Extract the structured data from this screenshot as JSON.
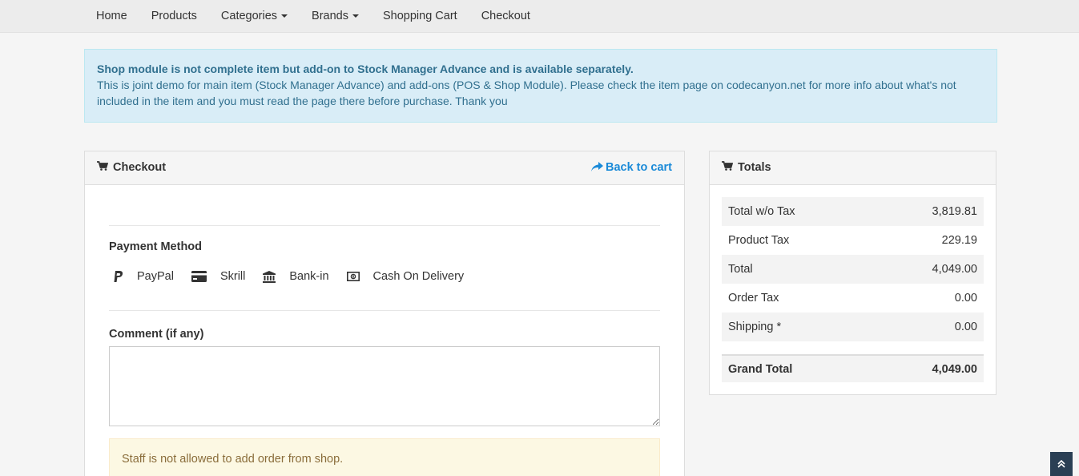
{
  "nav": {
    "items": [
      {
        "label": "Home",
        "dropdown": false
      },
      {
        "label": "Products",
        "dropdown": false
      },
      {
        "label": "Categories",
        "dropdown": true
      },
      {
        "label": "Brands",
        "dropdown": true
      },
      {
        "label": "Shopping Cart",
        "dropdown": false
      },
      {
        "label": "Checkout",
        "dropdown": false
      }
    ]
  },
  "notice": {
    "title": "Shop module is not complete item but add-on to Stock Manager Advance and is available separately.",
    "body": "This is joint demo for main item (Stock Manager Advance) and add-ons (POS & Shop Module). Please check the item page on codecanyon.net for more info about what's not included in the item and you must read the page there before purchase. Thank you"
  },
  "checkout": {
    "title": "Checkout",
    "back_label": "Back to cart",
    "payment_label": "Payment Method",
    "payment_methods": [
      {
        "label": "PayPal",
        "icon": "paypal-icon"
      },
      {
        "label": "Skrill",
        "icon": "credit-card-icon"
      },
      {
        "label": "Bank-in",
        "icon": "bank-icon"
      },
      {
        "label": "Cash On Delivery",
        "icon": "money-icon"
      }
    ],
    "comment_label": "Comment (if any)",
    "comment_value": "",
    "warning": "Staff is not allowed to add order from shop."
  },
  "totals": {
    "title": "Totals",
    "rows": [
      {
        "label": "Total w/o Tax",
        "value": "3,819.81"
      },
      {
        "label": "Product Tax",
        "value": "229.19"
      },
      {
        "label": "Total",
        "value": "4,049.00"
      },
      {
        "label": "Order Tax",
        "value": "0.00"
      },
      {
        "label": "Shipping *",
        "value": "0.00"
      }
    ],
    "grand_label": "Grand Total",
    "grand_value": "4,049.00"
  },
  "colors": {
    "link": "#1a8ad8",
    "info_bg": "#d9edf7",
    "warning_bg": "#fcf8e3",
    "scroll_btn": "#2a3f54"
  }
}
